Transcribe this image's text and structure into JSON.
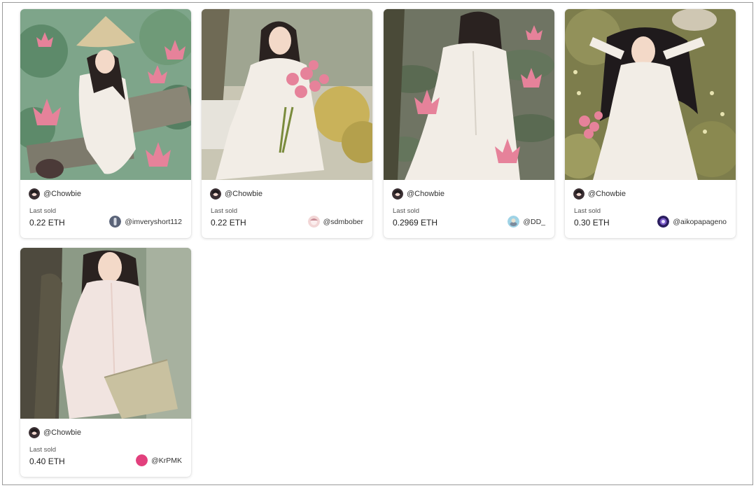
{
  "cards": [
    {
      "creator": "@Chowbie",
      "last_sold_label": "Last sold",
      "price": "0.22 ETH",
      "owner": "@imveryshort112"
    },
    {
      "creator": "@Chowbie",
      "last_sold_label": "Last sold",
      "price": "0.22 ETH",
      "owner": "@sdmbober"
    },
    {
      "creator": "@Chowbie",
      "last_sold_label": "Last sold",
      "price": "0.2969 ETH",
      "owner": "@DD_"
    },
    {
      "creator": "@Chowbie",
      "last_sold_label": "Last sold",
      "price": "0.30 ETH",
      "owner": "@aikopapageno"
    },
    {
      "creator": "@Chowbie",
      "last_sold_label": "Last sold",
      "price": "0.40 ETH",
      "owner": "@KrPMK"
    }
  ],
  "colors": {
    "lotus_pink": "#e6829a",
    "lotus_leaf": "#5d8a6a",
    "ao_dai_white": "#f2ede6",
    "hair": "#2a2220",
    "owner_krpmk_avatar": "#e2407d"
  },
  "icons": [
    "creator-avatar-icon",
    "owner-avatar-icon"
  ]
}
